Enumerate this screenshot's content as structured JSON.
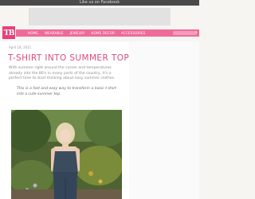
{
  "header": {
    "facebook_text": "Like us on Facebook",
    "logo_text": "TB"
  },
  "nav": {
    "items": [
      "HOME",
      "WEARABLE",
      "JEWELRY",
      "HOME DECOR",
      "ACCESSORIES"
    ],
    "more_symbol": "+"
  },
  "post": {
    "date": "April 18, 2011",
    "title": "T-SHIRT INTO SUMMER TOP DIY",
    "intro": "With summer right around the corner and temperatures already into the 80's in many parts of the country, it's a perfect time to start thinking about easy summer clothes.",
    "quote": "This is a fast and easy way to transform a basic t-shirt into a cute summer top."
  },
  "colors": {
    "accent": "#ee6a99",
    "title": "#d94b7b",
    "logo": "#ea3f7c"
  }
}
